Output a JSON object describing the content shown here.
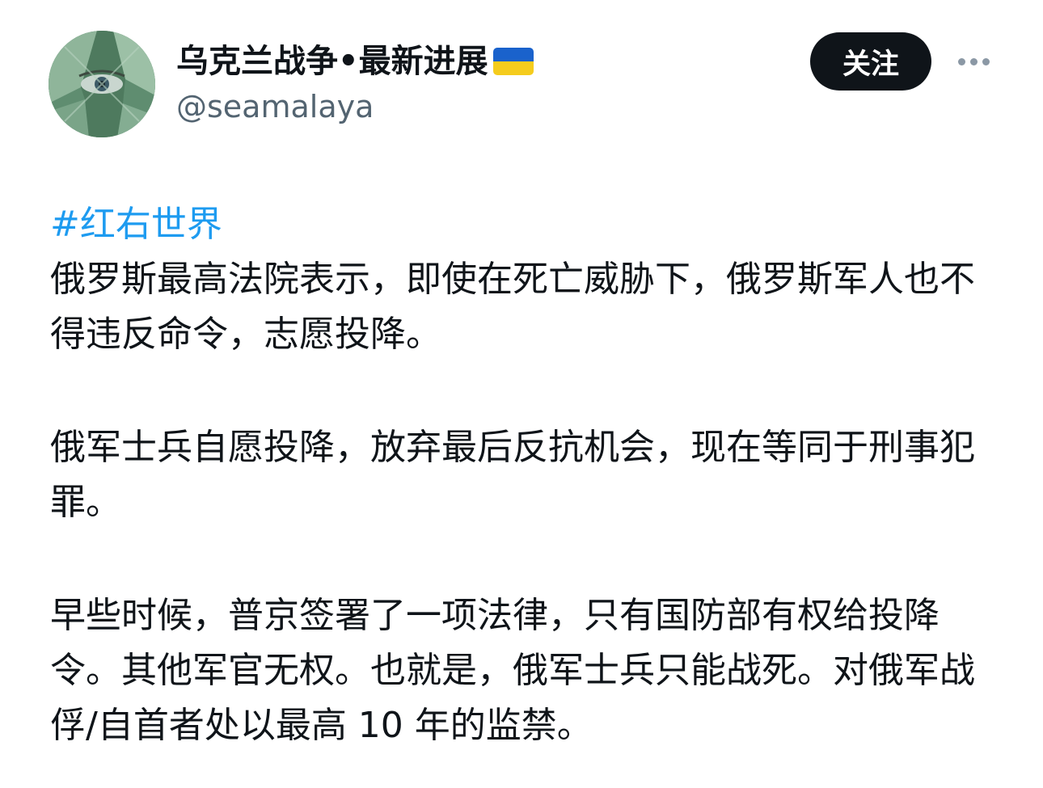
{
  "header": {
    "display_name": "乌克兰战争•最新进展",
    "flag_emoji": "ukraine-flag",
    "handle": "@seamalaya",
    "follow_label": "关注",
    "more_icon": "more-horizontal-icon"
  },
  "tweet": {
    "hashtag": "#红右世界",
    "paragraphs": [
      "俄罗斯最高法院表示，即使在死亡威胁下，俄罗斯军人也不得违反命令，志愿投降。",
      "俄军士兵自愿投降，放弃最后反抗机会，现在等同于刑事犯罪。",
      "早些时候，普京签署了一项法律，只有国防部有权给投降令。其他军官无权。也就是，俄军士兵只能战死。对俄军战俘/自首者处以最高 10 年的监禁。"
    ]
  },
  "colors": {
    "text": "#0f1419",
    "secondary": "#536471",
    "link": "#1d9bf0",
    "button_bg": "#0f1419",
    "flag_blue": "#1a62cc",
    "flag_yellow": "#f5cc1d"
  }
}
